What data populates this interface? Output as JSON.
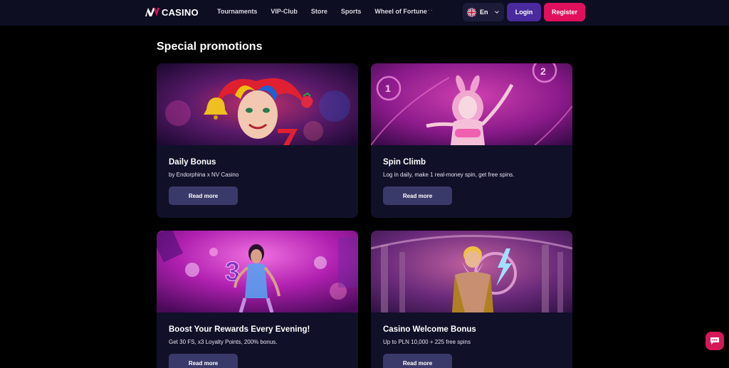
{
  "header": {
    "logo_mark": "NV",
    "logo_text": "CASINO",
    "nav": [
      {
        "label": "Tournaments"
      },
      {
        "label": "VIP-Club"
      },
      {
        "label": "Store"
      },
      {
        "label": "Sports"
      },
      {
        "label": "Wheel of Fortune"
      }
    ],
    "more_label": "···",
    "language": {
      "label": "En",
      "flag_icon": "uk-flag-icon"
    },
    "login_label": "Login",
    "register_label": "Register"
  },
  "main": {
    "section_title": "Special promotions",
    "promotions": [
      {
        "title": "Daily Bonus",
        "subtitle": "by Endorphina x NV Casino",
        "button_label": "Read more",
        "image": "jester-character"
      },
      {
        "title": "Spin Climb",
        "subtitle": "Log in daily, make 1 real-money spin, get free spins.",
        "button_label": "Read more",
        "image": "bunny-girl-character"
      },
      {
        "title": "Boost Your Rewards Every Evening!",
        "subtitle": "Get 30 FS, x3 Loyalty Points, 200% bonus.",
        "button_label": "Read more",
        "image": "neon-dancer-character"
      },
      {
        "title": "Casino Welcome Bonus",
        "subtitle": "Up to PLN 10,000 + 225 free spins",
        "button_label": "Read more",
        "image": "zeus-character"
      }
    ]
  },
  "chat": {
    "icon": "chat-icon"
  },
  "colors": {
    "header_bg": "#0e0e22",
    "page_bg": "#000000",
    "card_bg": "#111029",
    "button_bg": "#3a3a6a",
    "login_bg": "#4a2a9c",
    "register_bg": "#e0105c"
  }
}
